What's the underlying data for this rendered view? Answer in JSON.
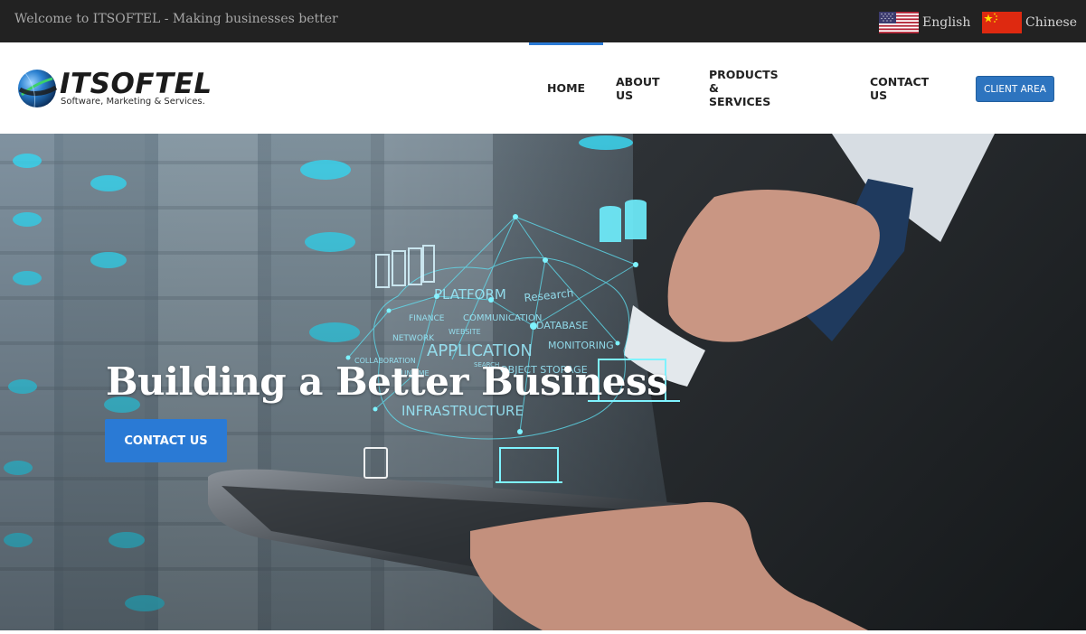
{
  "topbar": {
    "welcome_text": "Welcome to ITSOFTEL - Making businesses better",
    "languages": [
      {
        "label": "English",
        "flag": "us-flag-icon"
      },
      {
        "label": "Chinese",
        "flag": "cn-flag-icon"
      }
    ]
  },
  "header": {
    "logo_name": "ITSOFTEL",
    "logo_tagline": "Software, Marketing & Services.",
    "nav": [
      {
        "label": "HOME",
        "active": true
      },
      {
        "label": "ABOUT US",
        "active": false
      },
      {
        "label": "PRODUCTS & SERVICES",
        "active": false
      },
      {
        "label": "CONTACT US",
        "active": false
      }
    ],
    "client_area_label": "CLIENT AREA"
  },
  "hero": {
    "title": "Building a Better Business",
    "cta_label": "CONTACT US",
    "cloud_words": [
      "PLATFORM",
      "Research",
      "FINANCE",
      "COMMUNICATION",
      "NETWORK",
      "WEBSITE",
      "DATABASE",
      "APPLICATION",
      "MONITORING",
      "COLLABORATION",
      "SEARCH",
      "RUNTIME",
      "OBJECT STORAGE",
      "INFRASTRUCTURE"
    ]
  },
  "colors": {
    "topbar_bg": "#222222",
    "accent_blue": "#2a7ad5",
    "client_btn": "#2d74bf",
    "nav_text": "#222222"
  }
}
